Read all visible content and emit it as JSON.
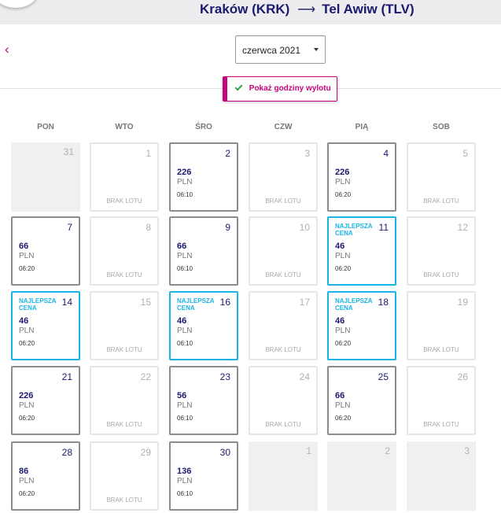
{
  "route": {
    "origin": "Kraków (KRK)",
    "arrow": "⟶",
    "destination": "Tel Awiw (TLV)"
  },
  "nav": {
    "back_icon": "‹"
  },
  "month_select": {
    "value": "czerwca 2021"
  },
  "toggle": {
    "label": "Pokaż godziny wylotu"
  },
  "weekdays": [
    "PON",
    "WTO",
    "ŚRO",
    "CZW",
    "PIĄ",
    "SOB"
  ],
  "colors": {
    "accent": "#c5037d",
    "navy": "#1a1a6e",
    "best": "#1ab5e4",
    "check": "#37a449"
  },
  "calendar": {
    "currency": "PLN",
    "no_flight_label": "BRAK LOTU",
    "best_price_label": "NAJLEPSZA CENA",
    "weeks": [
      [
        {
          "day": "31",
          "type": "out"
        },
        {
          "day": "1",
          "type": "none"
        },
        {
          "day": "2",
          "type": "flight",
          "price": "226",
          "time": "06:10"
        },
        {
          "day": "3",
          "type": "none"
        },
        {
          "day": "4",
          "type": "flight",
          "price": "226",
          "time": "06:20"
        },
        {
          "day": "5",
          "type": "none"
        }
      ],
      [
        {
          "day": "7",
          "type": "flight",
          "price": "66",
          "time": "06:20"
        },
        {
          "day": "8",
          "type": "none"
        },
        {
          "day": "9",
          "type": "flight",
          "price": "66",
          "time": "06:10"
        },
        {
          "day": "10",
          "type": "none"
        },
        {
          "day": "11",
          "type": "best",
          "price": "46",
          "time": "06:20"
        },
        {
          "day": "12",
          "type": "none"
        }
      ],
      [
        {
          "day": "14",
          "type": "best",
          "price": "46",
          "time": "06:20"
        },
        {
          "day": "15",
          "type": "none"
        },
        {
          "day": "16",
          "type": "best",
          "price": "46",
          "time": "06:10"
        },
        {
          "day": "17",
          "type": "none"
        },
        {
          "day": "18",
          "type": "best",
          "price": "46",
          "time": "06:20"
        },
        {
          "day": "19",
          "type": "none"
        }
      ],
      [
        {
          "day": "21",
          "type": "flight",
          "price": "226",
          "time": "06:20"
        },
        {
          "day": "22",
          "type": "none"
        },
        {
          "day": "23",
          "type": "flight",
          "price": "56",
          "time": "06:10"
        },
        {
          "day": "24",
          "type": "none"
        },
        {
          "day": "25",
          "type": "flight",
          "price": "66",
          "time": "06:20"
        },
        {
          "day": "26",
          "type": "none"
        }
      ],
      [
        {
          "day": "28",
          "type": "flight",
          "price": "86",
          "time": "06:20"
        },
        {
          "day": "29",
          "type": "none"
        },
        {
          "day": "30",
          "type": "flight",
          "price": "136",
          "time": "06:10"
        },
        {
          "day": "1",
          "type": "out"
        },
        {
          "day": "2",
          "type": "out"
        },
        {
          "day": "3",
          "type": "out"
        }
      ]
    ]
  }
}
